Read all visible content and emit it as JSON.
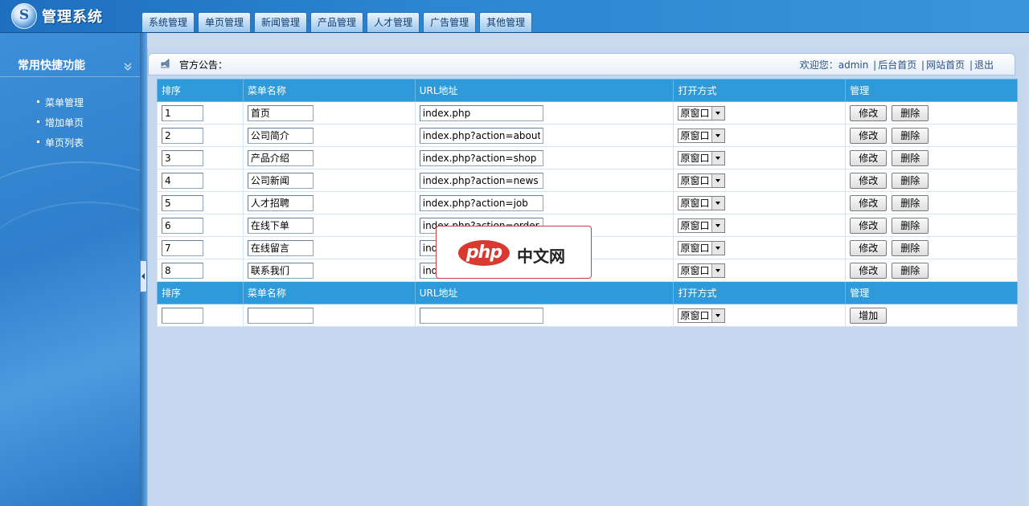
{
  "header": {
    "logo_text": "管理系统",
    "nav": [
      "系统管理",
      "单页管理",
      "新闻管理",
      "产品管理",
      "人才管理",
      "广告管理",
      "其他管理"
    ]
  },
  "sidebar": {
    "title": "常用快捷功能",
    "items": [
      "菜单管理",
      "增加单页",
      "单页列表"
    ]
  },
  "notice": {
    "label": "官方公告：",
    "welcome": "欢迎您：",
    "user": "admin",
    "links": [
      "后台首页",
      "网站首页",
      "退出"
    ]
  },
  "table": {
    "headers": [
      "排序",
      "菜单名称",
      "URL地址",
      "打开方式",
      "管理"
    ],
    "rows": [
      {
        "order": "1",
        "name": "首页",
        "url": "index.php",
        "open": "原窗口"
      },
      {
        "order": "2",
        "name": "公司简介",
        "url": "index.php?action=about&i",
        "open": "原窗口"
      },
      {
        "order": "3",
        "name": "产品介绍",
        "url": "index.php?action=shop",
        "open": "原窗口"
      },
      {
        "order": "4",
        "name": "公司新闻",
        "url": "index.php?action=news",
        "open": "原窗口"
      },
      {
        "order": "5",
        "name": "人才招聘",
        "url": "index.php?action=job",
        "open": "原窗口"
      },
      {
        "order": "6",
        "name": "在线下单",
        "url": "index.php?action=order",
        "open": "原窗口"
      },
      {
        "order": "7",
        "name": "在线留言",
        "url": "index.php?action=book",
        "open": "原窗口"
      },
      {
        "order": "8",
        "name": "联系我们",
        "url": "index.php?action=about&i",
        "open": "原窗口"
      }
    ],
    "edit_label": "修改",
    "delete_label": "删除",
    "new_row": {
      "order": "",
      "name": "",
      "url": "",
      "open": "原窗口",
      "add_label": "增加"
    }
  },
  "watermark": {
    "logo": "php",
    "text": "中文网"
  }
}
